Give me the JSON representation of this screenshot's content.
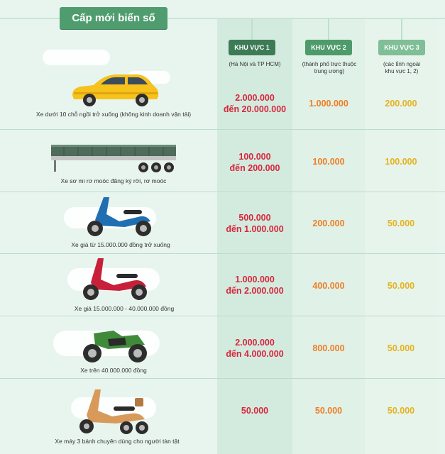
{
  "title": "Cấp mới biển số",
  "headers": [
    {
      "label": "KHU VỰC 1",
      "sub": [
        "(Hà Nội và TP HCM)"
      ]
    },
    {
      "label": "KHU VỰC 2",
      "sub": [
        "(thành phố trực thuộc",
        "trung ương)"
      ]
    },
    {
      "label": "KHU VỰC 3",
      "sub": [
        "(các tỉnh ngoài",
        "khu vực 1, 2)"
      ]
    }
  ],
  "rows": [
    {
      "vehicle": "Xe dưới 10 chỗ ngồi trở xuống (không kinh doanh vận tải)",
      "icon": "car-icon",
      "k1": [
        "2.000.000",
        "đến 20.000.000"
      ],
      "k2": "1.000.000",
      "k3": "200.000"
    },
    {
      "vehicle": "Xe sơ mi rơ moóc đăng ký rời, rơ moóc",
      "icon": "trailer-icon",
      "k1": [
        "100.000",
        "đến 200.000"
      ],
      "k2": "100.000",
      "k3": "100.000"
    },
    {
      "vehicle": "Xe giá từ 15.000.000 đồng trở xuống",
      "icon": "scooter-blue-icon",
      "k1": [
        "500.000",
        "đến 1.000.000"
      ],
      "k2": "200.000",
      "k3": "50.000"
    },
    {
      "vehicle": "Xe giá 15.000.000 - 40.000.000 đồng",
      "icon": "scooter-red-icon",
      "k1": [
        "1.000.000",
        "đến 2.000.000"
      ],
      "k2": "400.000",
      "k3": "50.000"
    },
    {
      "vehicle": "Xe trên 40.000.000 đồng",
      "icon": "sport-motorbike-icon",
      "k1": [
        "2.000.000",
        "đến 4.000.000"
      ],
      "k2": "800.000",
      "k3": "50.000"
    },
    {
      "vehicle": "Xe máy 3 bánh chuyên dùng cho người tàn tật",
      "icon": "three-wheel-scooter-icon",
      "k1": [
        "50.000"
      ],
      "k2": "50.000",
      "k3": "50.000"
    }
  ],
  "colors": {
    "k1": "#d7263d",
    "k2": "#ef7d24",
    "k3": "#e6b21e",
    "badge": "#4f9d6e"
  }
}
